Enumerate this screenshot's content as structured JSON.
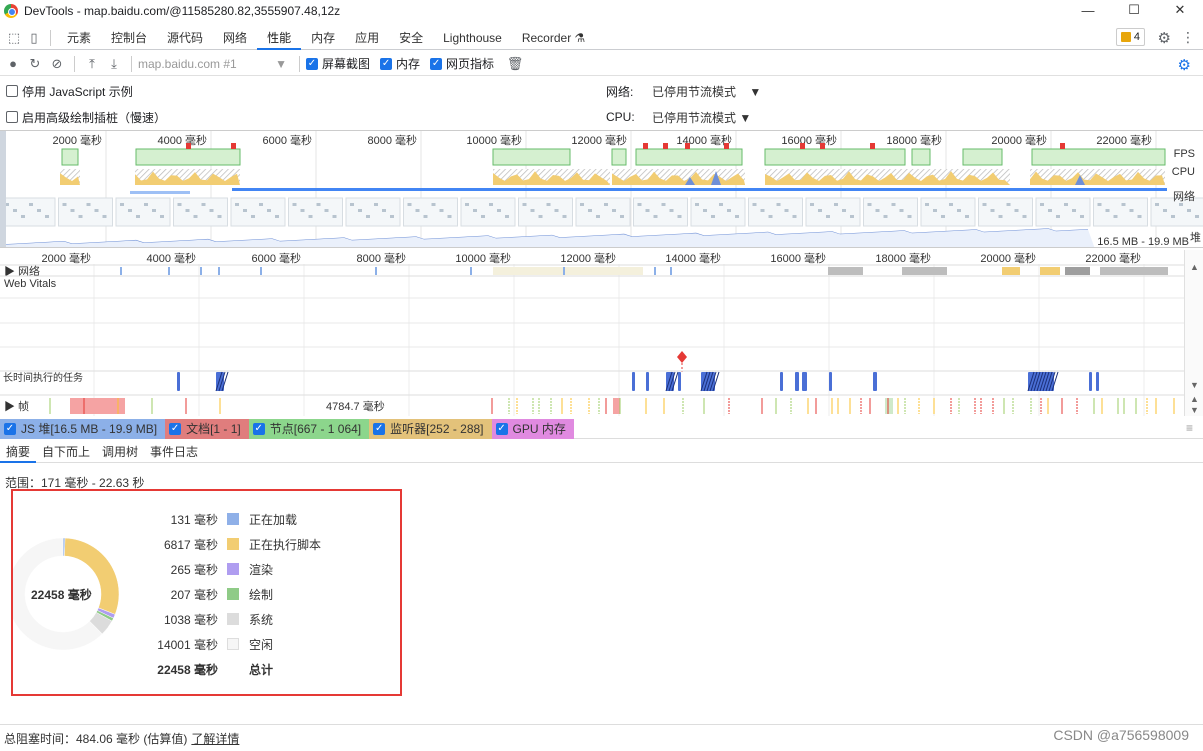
{
  "window": {
    "title": "DevTools - map.baidu.com/@11585280.82,3555907.48,12z"
  },
  "tabs": [
    "元素",
    "控制台",
    "源代码",
    "网络",
    "性能",
    "内存",
    "应用",
    "安全",
    "Lighthouse",
    "Recorder ⚗"
  ],
  "active_tab": "性能",
  "issues_count": "4",
  "perf_toolbar": {
    "target": "map.baidu.com #1",
    "screenshots": "屏幕截图",
    "memory": "内存",
    "web_vitals": "网页指标"
  },
  "settings": {
    "disable_js_samples": "停用 JavaScript 示例",
    "enable_paint": "启用高级绘制插桩（慢速）",
    "network_label": "网络:",
    "network_value": "已停用节流模式",
    "cpu_label": "CPU:",
    "cpu_value": "已停用节流模式"
  },
  "overview": {
    "ticks": [
      "2000 毫秒",
      "4000 毫秒",
      "6000 毫秒",
      "8000 毫秒",
      "10000 毫秒",
      "12000 毫秒",
      "14000 毫秒",
      "16000 毫秒",
      "18000 毫秒",
      "20000 毫秒",
      "22000 毫秒"
    ],
    "fps": "FPS",
    "cpu": "CPU",
    "net": "网络",
    "heap": "堆",
    "heap_range": "16.5 MB - 19.9 MB"
  },
  "timeline": {
    "ticks": [
      "2000 毫秒",
      "4000 毫秒",
      "6000 毫秒",
      "8000 毫秒",
      "10000 毫秒",
      "12000 毫秒",
      "14000 毫秒",
      "16000 毫秒",
      "18000 毫秒",
      "20000 毫秒",
      "22000 毫秒"
    ],
    "network_track": "网络",
    "web_vitals": "Web Vitals",
    "long_tasks": "长时间执行的任务",
    "frames": "帧",
    "frame_label": "4784.7 毫秒"
  },
  "memory_legend": [
    {
      "label": "JS 堆[16.5 MB - 19.9 MB]",
      "color": "#8cb0e8"
    },
    {
      "label": "文档[1 - 1]",
      "color": "#e07d7d"
    },
    {
      "label": "节点[667 - 1 064]",
      "color": "#8cd68c"
    },
    {
      "label": "监听器[252 - 288]",
      "color": "#e3c27a"
    },
    {
      "label": "GPU 内存",
      "color": "#e08ae0"
    }
  ],
  "bottom_tabs": [
    "摘要",
    "自下而上",
    "调用树",
    "事件日志"
  ],
  "active_bottom_tab": "摘要",
  "range": "范围：171 毫秒 - 22.63 秒",
  "summary": {
    "total": "22458 毫秒",
    "rows": [
      {
        "value": "131 毫秒",
        "name": "正在加载",
        "color": "#8fb0e8",
        "ms": 131
      },
      {
        "value": "6817 毫秒",
        "name": "正在执行脚本",
        "color": "#f2cd72",
        "ms": 6817
      },
      {
        "value": "265 毫秒",
        "name": "渲染",
        "color": "#af9df0",
        "ms": 265
      },
      {
        "value": "207 毫秒",
        "name": "绘制",
        "color": "#8fcb87",
        "ms": 207
      },
      {
        "value": "1038 毫秒",
        "name": "系统",
        "color": "#dcdcdc",
        "ms": 1038
      },
      {
        "value": "14001 毫秒",
        "name": "空闲",
        "color": "#f6f6f6",
        "ms": 14001
      }
    ],
    "total_row": {
      "value": "22458 毫秒",
      "name": "总计"
    }
  },
  "footer": {
    "text": "总阻塞时间：484.06 毫秒 (估算值)",
    "link": "了解详情"
  },
  "watermark": "CSDN @a756598009"
}
